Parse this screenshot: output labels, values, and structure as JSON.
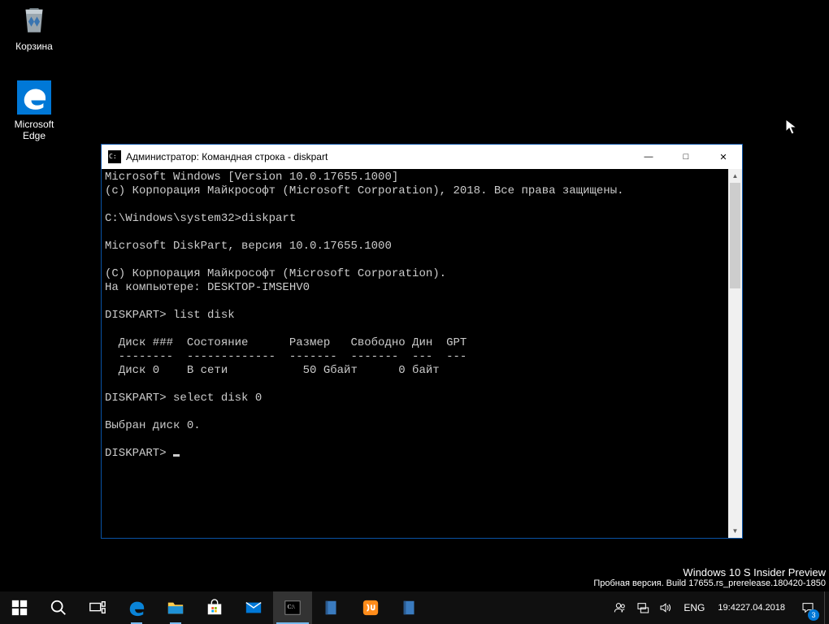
{
  "desktop": {
    "recycle_label": "Корзина",
    "edge_label": "Microsoft Edge"
  },
  "window": {
    "title": "Администратор: Командная строка - diskpart",
    "min_label": "—",
    "max_label": "☐",
    "close_label": "✕"
  },
  "terminal": {
    "lines": [
      "Microsoft Windows [Version 10.0.17655.1000]",
      "(c) Корпорация Майкрософт (Microsoft Corporation), 2018. Все права защищены.",
      "",
      "C:\\Windows\\system32>diskpart",
      "",
      "Microsoft DiskPart, версия 10.0.17655.1000",
      "",
      "(C) Корпорация Майкрософт (Microsoft Corporation).",
      "На компьютере: DESKTOP-IMSEHV0",
      "",
      "DISKPART> list disk",
      "",
      "  Диск ###  Состояние      Размер   Свободно Дин  GPT",
      "  --------  -------------  -------  -------  ---  ---",
      "  Диск 0    В сети           50 Gбайт      0 байт",
      "",
      "DISKPART> select disk 0",
      "",
      "Выбран диск 0.",
      "",
      "DISKPART> "
    ]
  },
  "watermark": {
    "line1": "Windows 10 S Insider Preview",
    "line2": "Пробная версия. Build 17655.rs_prerelease.180420-1850"
  },
  "tray": {
    "lang": "ENG",
    "time": "19:42",
    "date": "27.04.2018",
    "badge": "3"
  },
  "icons": {
    "start": "start-icon",
    "search": "search-icon",
    "taskview": "taskview-icon",
    "edge": "edge-icon",
    "explorer": "explorer-icon",
    "store": "store-icon",
    "mail": "mail-icon",
    "cmd": "cmd-icon",
    "app1": "app1-icon",
    "app2": "app2-icon",
    "app3": "app3-icon",
    "people": "people-icon",
    "network": "network-icon",
    "volume": "volume-icon",
    "action": "action-center-icon"
  }
}
